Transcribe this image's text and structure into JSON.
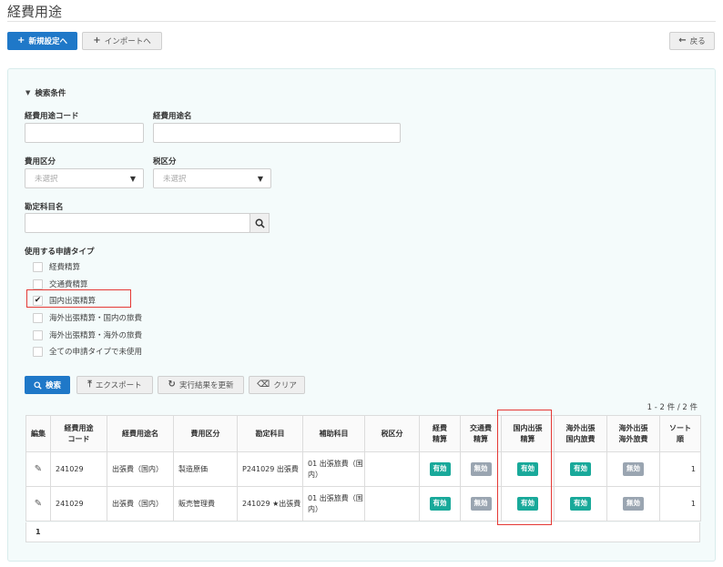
{
  "title": "経費用途",
  "toolbar": {
    "new_label": "新規設定へ",
    "import_label": "インポートへ",
    "back_label": "戻る"
  },
  "search": {
    "section_label": "検索条件",
    "code_label": "経費用途コード",
    "name_label": "経費用途名",
    "cost_category_label": "費用区分",
    "cost_category_value": "未選択",
    "tax_label": "税区分",
    "tax_value": "未選択",
    "account_label": "勘定科目名",
    "apply_types_label": "使用する申請タイプ",
    "apply_types": [
      {
        "label": "経費精算",
        "checked": false
      },
      {
        "label": "交通費精算",
        "checked": false
      },
      {
        "label": "国内出張精算",
        "checked": true
      },
      {
        "label": "海外出張精算・国内の旅費",
        "checked": false
      },
      {
        "label": "海外出張精算・海外の旅費",
        "checked": false
      },
      {
        "label": "全ての申請タイプで未使用",
        "checked": false
      }
    ]
  },
  "actions": {
    "search_label": "検索",
    "export_label": "エクスポート",
    "refresh_label": "実行結果を更新",
    "clear_label": "クリア"
  },
  "results": {
    "count": "1 - 2 件 / 2 件",
    "headers": [
      "編集",
      "経費用途\nコード",
      "経費用途名",
      "費用区分",
      "勘定科目",
      "補助科目",
      "税区分",
      "経費\n精算",
      "交通費\n精算",
      "国内出張\n精算",
      "海外出張\n国内旅費",
      "海外出張\n海外旅費",
      "ソート\n順"
    ],
    "rows": [
      {
        "code": "241029",
        "name": "出張費（国内）",
        "cost_category": "製造原価",
        "account": "P241029 出張費",
        "sub_account": "01 出張旅費（国内）",
        "tax": "",
        "expense": "有効",
        "transport": "無効",
        "domestic": "有効",
        "overseas_domestic": "有効",
        "overseas_overseas": "無効",
        "sort": "1"
      },
      {
        "code": "241029",
        "name": "出張費（国内）",
        "cost_category": "販売管理費",
        "account": "241029 ★出張費",
        "sub_account": "01 出張旅費（国内）",
        "tax": "",
        "expense": "有効",
        "transport": "無効",
        "domestic": "有効",
        "overseas_domestic": "有効",
        "overseas_overseas": "無効",
        "sort": "1"
      }
    ],
    "page": "1"
  },
  "colors": {
    "primary": "#1f78c8",
    "enabled": "#19a99a",
    "disabled": "#9aa5b1",
    "highlight": "#e53935"
  }
}
